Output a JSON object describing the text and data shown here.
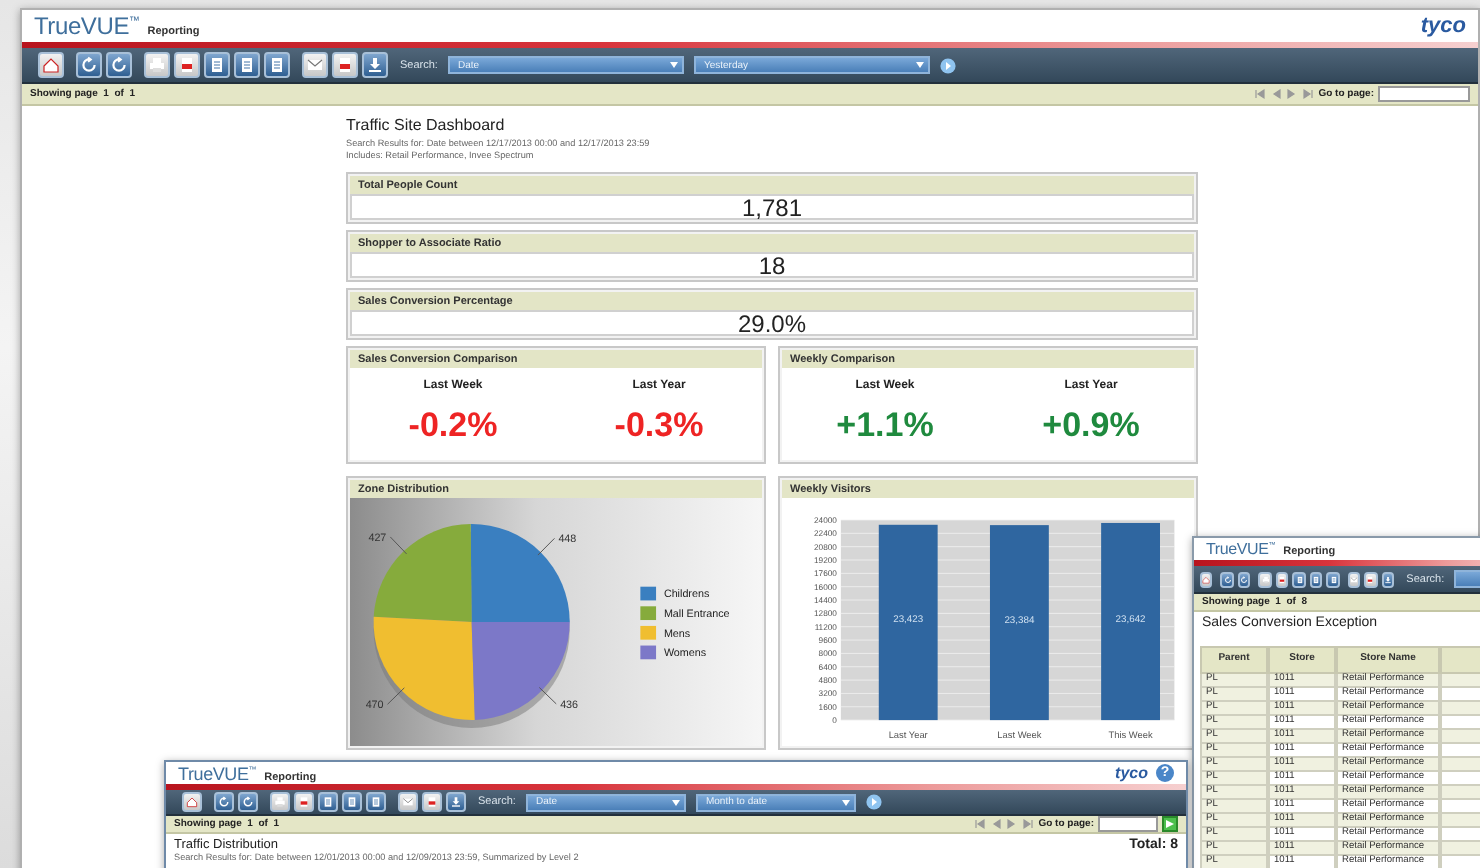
{
  "main_window": {
    "header": {
      "logo": "TrueVUE$^{™}$",
      "module": "Reporting",
      "brand": "tyco"
    },
    "toolbar": {
      "search_label": "Search:",
      "field": "Date",
      "period": "Yesterday"
    },
    "paging": {
      "status": "Showing page  1  of  1",
      "go_to_label": "Go to page:"
    },
    "report": {
      "title": "Traffic Site Dashboard",
      "subtitle": [
        "Search Results for: Date between 12/17/2013 00:00 and 12/17/2013 23:59",
        "Includes: Retail Performance, Invee Spectrum"
      ],
      "metrics": [
        {
          "title": "Total People Count",
          "value": "1,781"
        },
        {
          "title": "Shopper to Associate Ratio",
          "value": "18"
        },
        {
          "title": "Sales Conversion Percentage",
          "value": "29.0%"
        }
      ],
      "comparisons": [
        {
          "title": "Sales Conversion Comparison",
          "items": [
            {
              "label": "Last Week",
              "value": "-0.2%",
              "color": "#ee2424"
            },
            {
              "label": "Last Year",
              "value": "-0.3%",
              "color": "#ee2424"
            }
          ]
        },
        {
          "title": "Weekly Comparison",
          "items": [
            {
              "label": "Last Week",
              "value": "+1.1%",
              "color": "#1f8a3e"
            },
            {
              "label": "Last Year",
              "value": "+0.9%",
              "color": "#1f8a3e"
            }
          ]
        }
      ],
      "charts": [
        {
          "chart_data": {
            "type": "pie",
            "title": "Zone Distribution",
            "categories": [
              "Childrens",
              "Mall Entrance",
              "Mens",
              "Womens"
            ],
            "values": [
              448,
              427,
              470,
              436
            ],
            "data_labels": true,
            "legend": "right"
          }
        },
        {
          "chart_data": {
            "type": "bar",
            "title": "Weekly Visitors",
            "categories": [
              "Last Year",
              "Last Week",
              "This Week"
            ],
            "values": [
              23423,
              23384,
              23642
            ],
            "ylim": [
              0,
              24000
            ],
            "yticks": [
              0,
              1600,
              3200,
              4800,
              6400,
              8000,
              9600,
              11200,
              12800,
              14400,
              16000,
              17600,
              19200,
              20800,
              22400,
              24000
            ],
            "value_labels": [
              "23,423",
              "23,384",
              "23,642"
            ],
            "grid": true
          }
        }
      ]
    }
  },
  "sales_window": {
    "header": {
      "logo": "TrueVUE$^{™}$",
      "module": "Reporting"
    },
    "toolbar": {
      "search_label": "Search:"
    },
    "paging": {
      "status": "Showing page  1  of  8"
    },
    "report": {
      "title": "Sales Conversion Exception",
      "table": {
        "columns": [
          "Parent",
          "Store",
          "Store Name"
        ],
        "rows": [
          [
            "PL",
            "1011",
            "Retail Performance"
          ],
          [
            "PL",
            "1011",
            "Retail Performance"
          ],
          [
            "PL",
            "1011",
            "Retail Performance"
          ],
          [
            "PL",
            "1011",
            "Retail Performance"
          ],
          [
            "PL",
            "1011",
            "Retail Performance"
          ],
          [
            "PL",
            "1011",
            "Retail Performance"
          ],
          [
            "PL",
            "1011",
            "Retail Performance"
          ],
          [
            "PL",
            "1011",
            "Retail Performance"
          ],
          [
            "PL",
            "1011",
            "Retail Performance"
          ],
          [
            "PL",
            "1011",
            "Retail Performance"
          ],
          [
            "PL",
            "1011",
            "Retail Performance"
          ],
          [
            "PL",
            "1011",
            "Retail Performance"
          ],
          [
            "PL",
            "1011",
            "Retail Performance"
          ],
          [
            "PL",
            "1011",
            "Retail Performance"
          ]
        ]
      }
    }
  },
  "distribution_window": {
    "header": {
      "logo": "TrueVUE$^{™}$",
      "module": "Reporting",
      "brand": "tyco",
      "help": "?"
    },
    "toolbar": {
      "search_label": "Search:",
      "field": "Date",
      "period": "Month to date"
    },
    "paging": {
      "status": "Showing page  1  of  1",
      "go_to_label": "Go to page:"
    },
    "report": {
      "title": "Traffic Distribution",
      "total": "Total: 8",
      "subtitle": [
        "Search Results for: Date between 12/01/2013 00:00 and 12/09/2013 23:59, Summarized by Level 2"
      ]
    }
  }
}
